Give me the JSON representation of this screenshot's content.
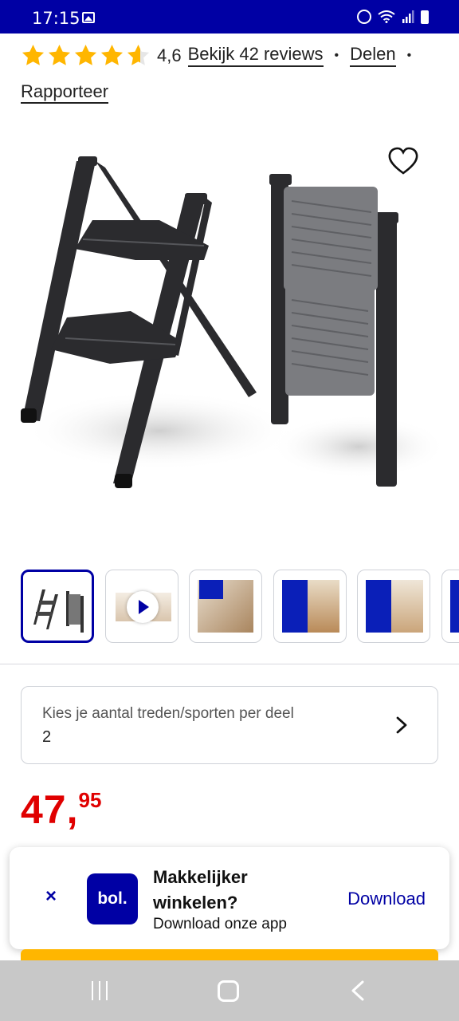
{
  "status_bar": {
    "time": "17:15",
    "icons": [
      "gallery-icon",
      "alarm-icon",
      "wifi-icon",
      "signal-icon",
      "battery-icon"
    ]
  },
  "rating": {
    "stars": 4.6,
    "value": "4,6",
    "reviews_link": "Bekijk 42 reviews",
    "share_link": "Delen",
    "separator": "•",
    "report_link": "Rapporteer"
  },
  "product": {
    "image": "foldable-step-ladder",
    "wishlist_icon": "heart-icon"
  },
  "thumbnails": [
    {
      "kind": "image",
      "active": true
    },
    {
      "kind": "video",
      "icon": "play-icon"
    },
    {
      "kind": "image"
    },
    {
      "kind": "image"
    },
    {
      "kind": "image"
    },
    {
      "kind": "image"
    }
  ],
  "variant": {
    "label": "Kies je aantal treden/sporten per deel",
    "value": "2",
    "icon": "chevron-right-icon"
  },
  "price": {
    "euros": "47,",
    "cents": "95"
  },
  "app_banner": {
    "logo_text": "bol.",
    "title": "Makkelijker winkelen?",
    "subtitle": "Download onze app",
    "download_label": "Download",
    "close_label": "×"
  },
  "colors": {
    "brand": "#0000a4",
    "price": "#e00000",
    "star": "#ffb600",
    "accent_strip": "#ffb600"
  },
  "nav_bar": {
    "icons": [
      "recents-icon",
      "home-icon",
      "back-icon"
    ]
  }
}
